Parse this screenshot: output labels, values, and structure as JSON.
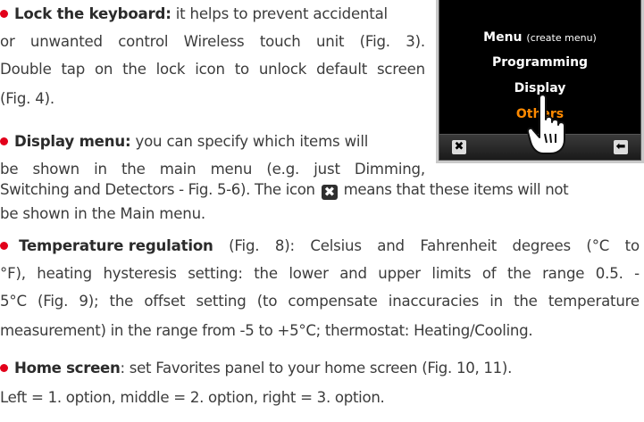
{
  "device_screen": {
    "menu_items": [
      {
        "label": "Menu",
        "note": "(create menu)"
      },
      {
        "label": "Programming"
      },
      {
        "label": "Display"
      },
      {
        "label": "Others"
      }
    ],
    "close_glyph": "✖",
    "back_glyph": "⬅",
    "icons": {
      "close": "close-icon",
      "back": "back-arrow-icon",
      "hand": "tap-hand-icon"
    },
    "active_color": "#ff8a00"
  },
  "paragraphs": {
    "lock": {
      "title": "Lock the keyboard:",
      "line1_words": [
        "it",
        "helps",
        "to",
        "prevent",
        "accidental"
      ],
      "line2_words": [
        "or",
        "unwanted",
        "control",
        "Wireless",
        "touch",
        "unit",
        "(Fig.",
        "3)."
      ],
      "line3_words": [
        "Double",
        "tap",
        "on",
        "the",
        "lock",
        "icon",
        "to",
        "unlock",
        "default",
        "screen"
      ],
      "line4": "(Fig. 4)."
    },
    "display": {
      "title": "Display menu:",
      "line1_words": [
        "you",
        "can",
        "specify",
        "which",
        "items",
        "will"
      ],
      "line2_words": [
        "be",
        "shown",
        "in",
        "the",
        "main",
        "menu",
        "(e.g.",
        "just",
        "Dimming,"
      ],
      "line3_before": "Switching and Detectors - Fig. 5-6). The icon",
      "line3_after": "means that these items will not",
      "line4": "be shown in the Main menu.",
      "icon_name": "close-icon",
      "icon_glyph": "✖"
    },
    "temperature": {
      "title": "Temperature regulation",
      "line1_words": [
        "(Fig.",
        "8):",
        "",
        "Celsius",
        "and",
        "Fahrenheit",
        "degrees",
        "(°C",
        "to"
      ],
      "line2_words": [
        "°F),",
        "heating",
        "hysteresis",
        "setting:",
        "",
        "the",
        "lower",
        "and",
        "upper",
        "limits",
        "of",
        "the",
        "range",
        "0.5.",
        "-"
      ],
      "line3_words": [
        "5°C",
        "(Fig.",
        "9);",
        "the",
        "offset",
        "setting",
        "(to",
        "compensate",
        "inaccuracies",
        "in",
        "the",
        "temperature"
      ],
      "line4": "measurement) in the range from -5 to +5°C; thermostat: Heating/Cooling."
    },
    "home": {
      "title": "Home screen",
      "rest": ": set Favorites panel to your home screen (Fig. 10, 11).",
      "line2": "Left = 1. option, middle = 2. option, right = 3. option."
    }
  },
  "colors": {
    "bullet": "#e2001a",
    "text": "#3c3c3c",
    "screen": "#000000"
  }
}
